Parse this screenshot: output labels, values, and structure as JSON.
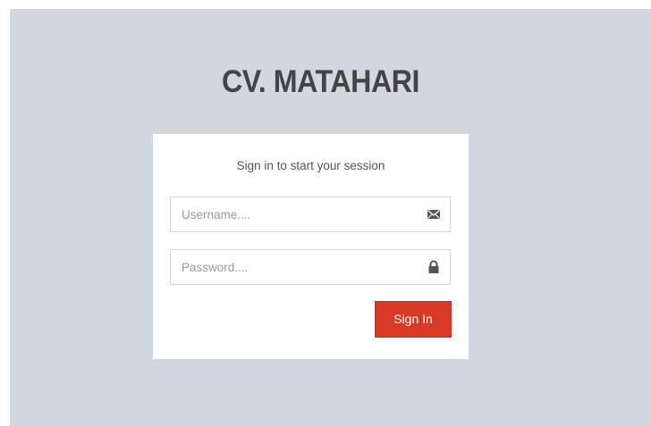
{
  "logo": {
    "text": "CV. MATAHARI"
  },
  "login": {
    "message": "Sign in to start your session",
    "username": {
      "value": "",
      "placeholder": "Username....",
      "icon": "envelope-icon"
    },
    "password": {
      "value": "",
      "placeholder": "Password....",
      "icon": "lock-icon"
    },
    "submit_label": "Sign In"
  },
  "colors": {
    "background": "#d2d6de",
    "box": "#ffffff",
    "button": "#d73925",
    "logo_text": "#444444"
  }
}
